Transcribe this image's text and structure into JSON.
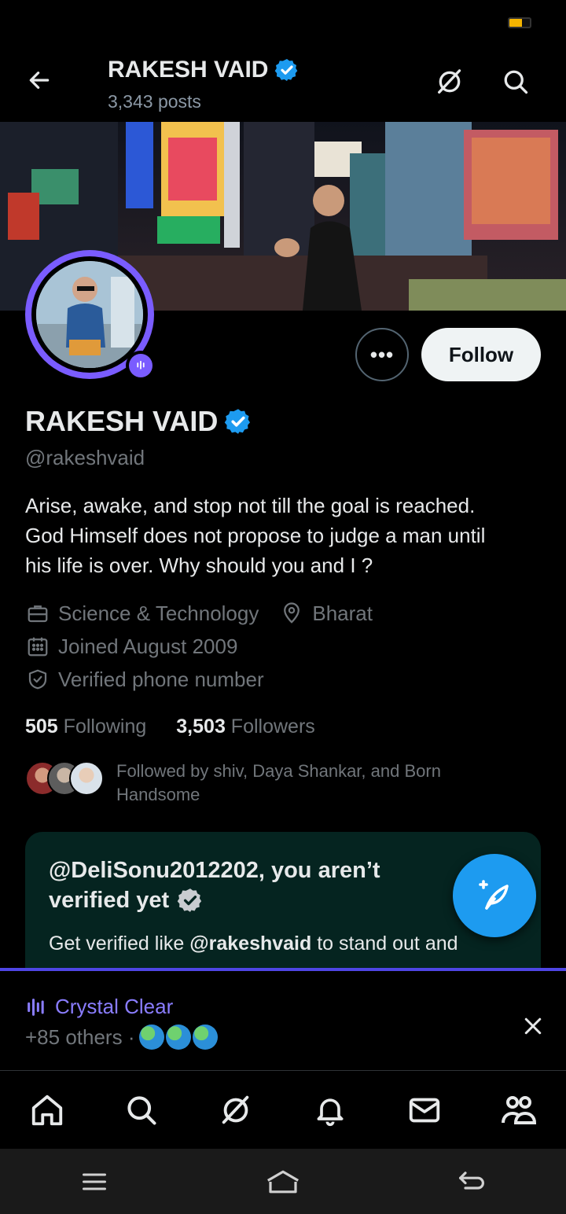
{
  "header": {
    "title": "RAKESH VAID",
    "posts_count": "3,343 posts"
  },
  "profile": {
    "name": "RAKESH VAID",
    "handle": "@rakeshvaid",
    "bio_lines": [
      "Arise, awake, and stop not till the goal is reached.",
      "God Himself does not propose to judge a man until",
      "his life is over. Why should you and I ?"
    ],
    "category": "Science & Technology",
    "location": "Bharat",
    "joined": "Joined August 2009",
    "verified_phone": "Verified phone number",
    "following_count": "505",
    "following_label": "Following",
    "followers_count": "3,503",
    "followers_label": "Followers",
    "followed_by": "Followed by shiv, Daya Shankar, and Born Handsome",
    "more_label": "•••",
    "follow_label": "Follow"
  },
  "verify_card": {
    "title_line1": "@DeliSonu2012202, you aren’t",
    "title_line2": "verified yet",
    "body_prefix": "Get verified like ",
    "body_handle": "@rakeshvaid",
    "body_suffix": " to stand out and"
  },
  "space": {
    "title": "Crystal Clear",
    "listeners": "+85 others ·"
  },
  "colors": {
    "accent_blue": "#1d9bf0",
    "space_purple": "#7a5cff",
    "card_bg": "#052420",
    "battery": "#f4b400"
  },
  "icons": {
    "back": "arrow-left-icon",
    "grok": "grok-icon",
    "search": "search-icon",
    "verified": "verified-badge-icon",
    "briefcase": "briefcase-icon",
    "location": "location-pin-icon",
    "calendar": "calendar-icon",
    "shield": "shield-check-icon",
    "compose": "compose-feather-icon",
    "close": "close-icon"
  },
  "battery_level": 0.6
}
